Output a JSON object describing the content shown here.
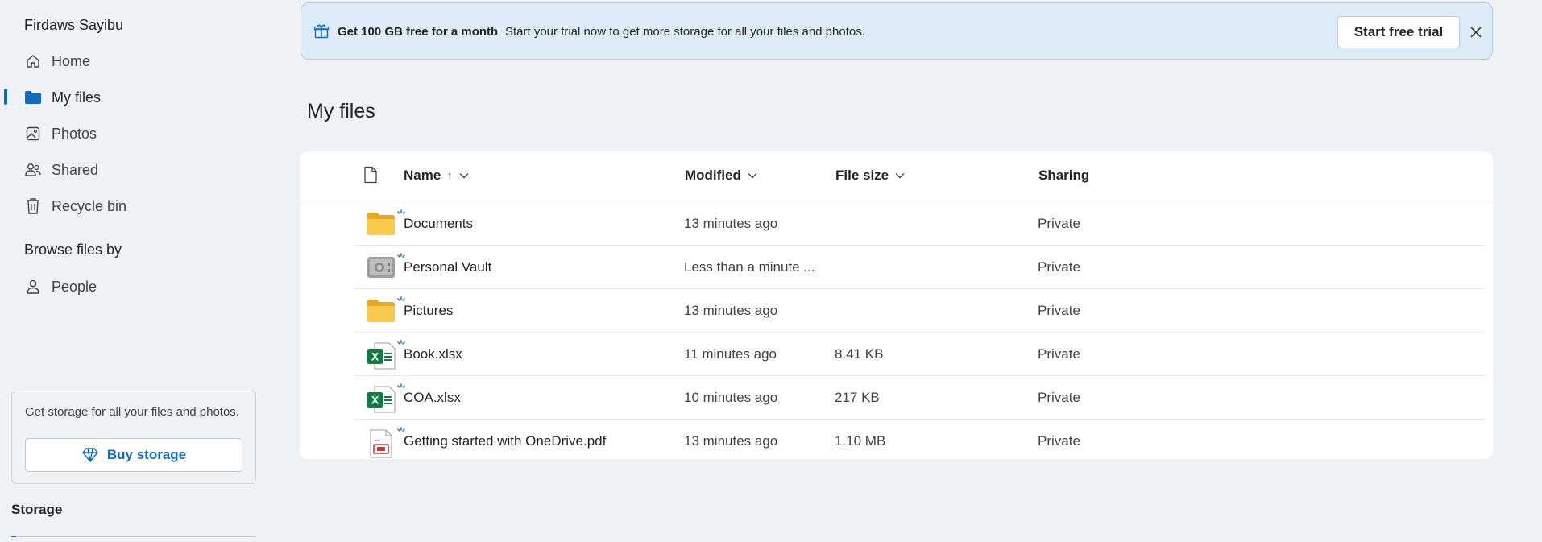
{
  "sidebar": {
    "user_name": "Firdaws Sayibu",
    "nav": [
      {
        "label": "Home",
        "icon": "home-icon"
      },
      {
        "label": "My files",
        "icon": "folder-icon",
        "active": true
      },
      {
        "label": "Photos",
        "icon": "photo-icon"
      },
      {
        "label": "Shared",
        "icon": "people-icon"
      },
      {
        "label": "Recycle bin",
        "icon": "trash-icon"
      }
    ],
    "browse_title": "Browse files by",
    "browse": [
      {
        "label": "People",
        "icon": "person-icon"
      }
    ],
    "promo_text": "Get storage for all your files and photos.",
    "buy_label": "Buy storage",
    "storage_title": "Storage"
  },
  "banner": {
    "title": "Get 100 GB free for a month",
    "desc": "Start your trial now to get more storage for all your files and photos.",
    "button": "Start free trial"
  },
  "page_title": "My files",
  "table": {
    "headers": {
      "name": "Name",
      "sort_arrow": "↑",
      "modified": "Modified",
      "size": "File size",
      "sharing": "Sharing"
    },
    "rows": [
      {
        "name": "Documents",
        "type": "folder",
        "modified": "13 minutes ago",
        "size": "",
        "sharing": "Private"
      },
      {
        "name": "Personal Vault",
        "type": "vault",
        "modified": "Less than a minute ...",
        "size": "",
        "sharing": "Private"
      },
      {
        "name": "Pictures",
        "type": "folder",
        "modified": "13 minutes ago",
        "size": "",
        "sharing": "Private"
      },
      {
        "name": "Book.xlsx",
        "type": "excel",
        "modified": "11 minutes ago",
        "size": "8.41 KB",
        "sharing": "Private"
      },
      {
        "name": "COA.xlsx",
        "type": "excel",
        "modified": "10 minutes ago",
        "size": "217 KB",
        "sharing": "Private"
      },
      {
        "name": "Getting started with OneDrive.pdf",
        "type": "pdf",
        "modified": "13 minutes ago",
        "size": "1.10 MB",
        "sharing": "Private"
      }
    ]
  },
  "colors": {
    "accent": "#0f6cbd",
    "banner_bg": "#deecf9",
    "folder": "#f8c94a",
    "excel": "#107c41",
    "pdf": "#d13438"
  }
}
